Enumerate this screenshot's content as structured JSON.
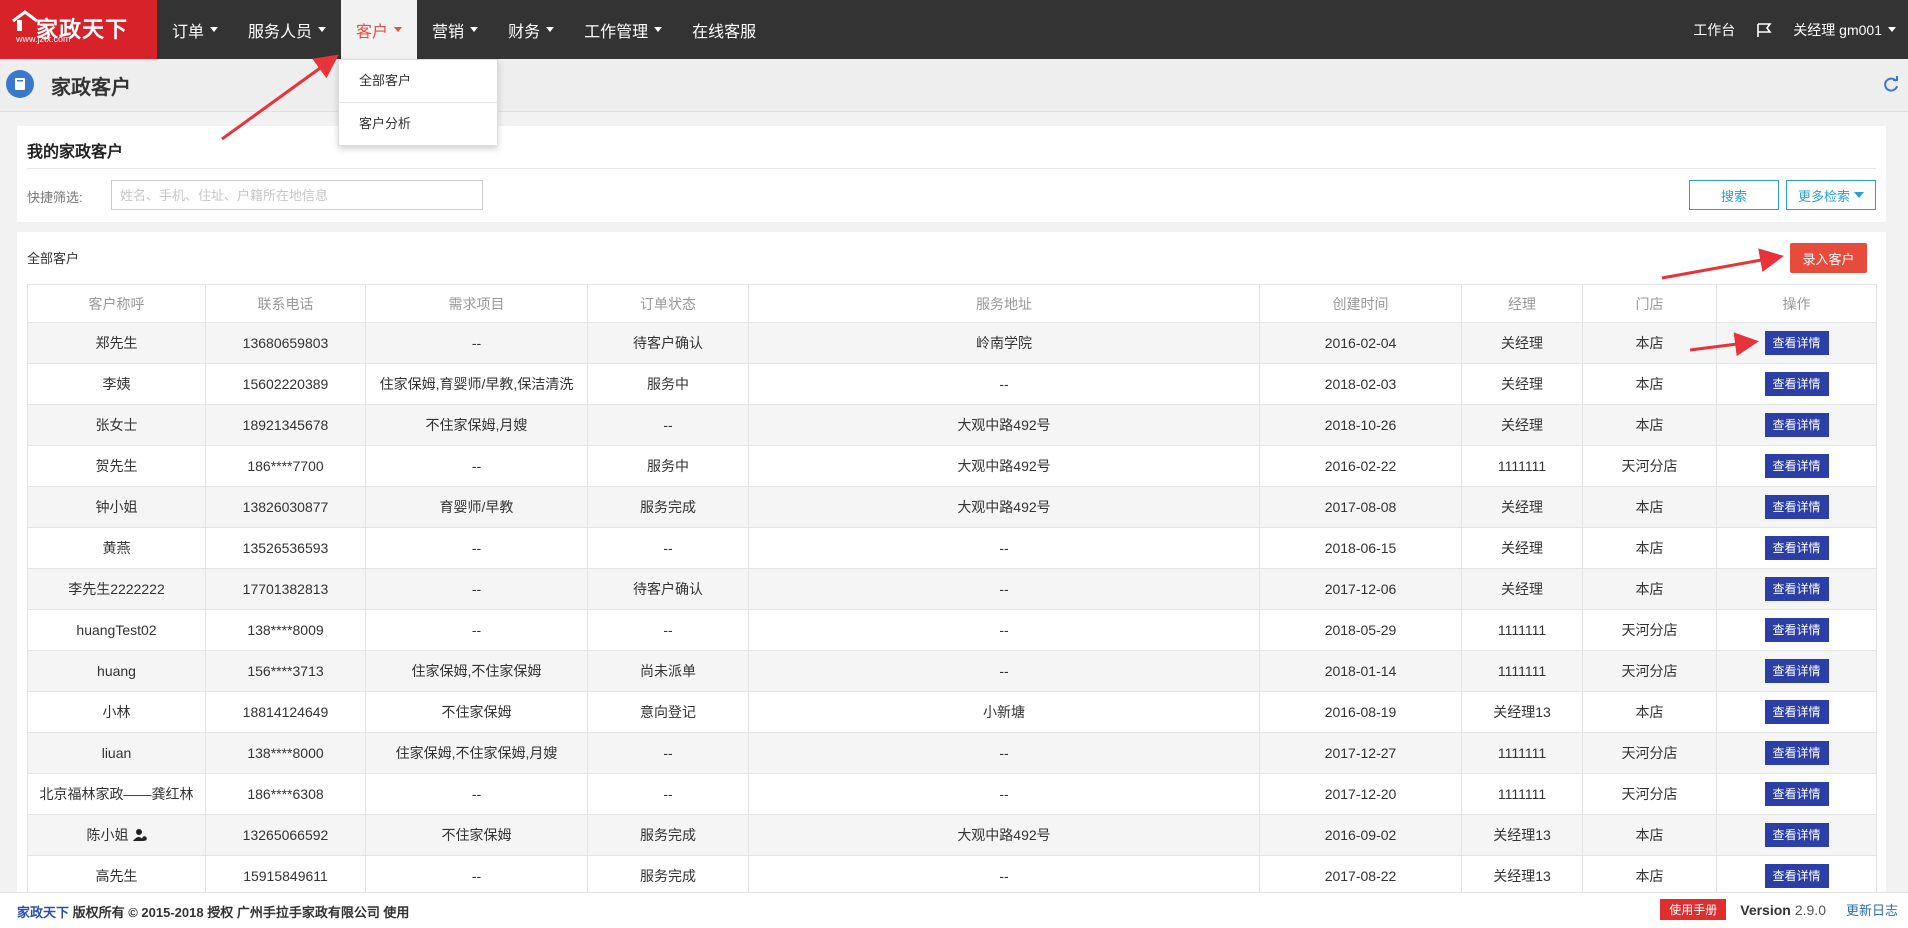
{
  "logo": {
    "text": "家政天下",
    "url": "www.jztx.com"
  },
  "nav": {
    "items": [
      {
        "label": "订单",
        "caret": true,
        "active": false
      },
      {
        "label": "服务人员",
        "caret": true,
        "active": false
      },
      {
        "label": "客户",
        "caret": true,
        "active": true
      },
      {
        "label": "营销",
        "caret": true,
        "active": false
      },
      {
        "label": "财务",
        "caret": true,
        "active": false
      },
      {
        "label": "工作管理",
        "caret": true,
        "active": false
      },
      {
        "label": "在线客服",
        "caret": false,
        "active": false
      }
    ],
    "right": {
      "workbench": "工作台",
      "user": "关经理 gm001"
    }
  },
  "dropdown": {
    "items": [
      "全部客户",
      "客户分析"
    ]
  },
  "page_header": {
    "title": "家政客户"
  },
  "filter": {
    "title": "我的家政客户",
    "label": "快捷筛选:",
    "placeholder": "姓名、手机、住址、户籍所在地信息",
    "search_label": "搜索",
    "more_label": "更多检索"
  },
  "list": {
    "title": "全部客户",
    "add_label": "录入客户",
    "detail_label": "查看详情",
    "columns": [
      "客户称呼",
      "联系电话",
      "需求项目",
      "订单状态",
      "服务地址",
      "创建时间",
      "经理",
      "门店",
      "操作"
    ],
    "rows": [
      [
        "郑先生",
        "13680659803",
        "--",
        "待客户确认",
        "岭南学院",
        "2016-02-04",
        "关经理",
        "本店"
      ],
      [
        "李姨",
        "15602220389",
        "住家保姆,育婴师/早教,保洁清洗",
        "服务中",
        "--",
        "2018-02-03",
        "关经理",
        "本店"
      ],
      [
        "张女士",
        "18921345678",
        "不住家保姆,月嫂",
        "--",
        "大观中路492号",
        "2018-10-26",
        "关经理",
        "本店"
      ],
      [
        "贺先生",
        "186****7700",
        "--",
        "服务中",
        "大观中路492号",
        "2016-02-22",
        "1111111",
        "天河分店"
      ],
      [
        "钟小姐",
        "13826030877",
        "育婴师/早教",
        "服务完成",
        "大观中路492号",
        "2017-08-08",
        "关经理",
        "本店"
      ],
      [
        "黄燕",
        "13526536593",
        "--",
        "--",
        "--",
        "2018-06-15",
        "关经理",
        "本店"
      ],
      [
        "李先生2222222",
        "17701382813",
        "--",
        "待客户确认",
        "--",
        "2017-12-06",
        "关经理",
        "本店"
      ],
      [
        "huangTest02",
        "138****8009",
        "--",
        "--",
        "--",
        "2018-05-29",
        "1111111",
        "天河分店"
      ],
      [
        "huang",
        "156****3713",
        "住家保姆,不住家保姆",
        "尚未派单",
        "--",
        "2018-01-14",
        "1111111",
        "天河分店"
      ],
      [
        "小林",
        "18814124649",
        "不住家保姆",
        "意向登记",
        "小新塘",
        "2016-08-19",
        "关经理13",
        "本店"
      ],
      [
        "liuan",
        "138****8000",
        "住家保姆,不住家保姆,月嫂",
        "--",
        "--",
        "2017-12-27",
        "1111111",
        "天河分店"
      ],
      [
        "北京福林家政——龚红林",
        "186****6308",
        "--",
        "--",
        "--",
        "2017-12-20",
        "1111111",
        "天河分店"
      ],
      [
        "陈小姐",
        "13265066592",
        "不住家保姆",
        "服务完成",
        "大观中路492号",
        "2016-09-02",
        "关经理13",
        "本店"
      ],
      [
        "高先生",
        "15915849611",
        "--",
        "服务完成",
        "--",
        "2017-08-22",
        "关经理13",
        "本店"
      ]
    ]
  },
  "footer": {
    "brand": "家政天下",
    "copyright": " 版权所有 © 2015-2018 授权 广州手拉手家政有限公司 使用",
    "manual": "使用手册",
    "version_label": "Version",
    "version": "2.9.0",
    "changelog": "更新日志"
  },
  "colors": {
    "topbar": "#333333",
    "logo_bg": "#d8222a",
    "active_nav_text": "#e74c3c",
    "primary_blue": "#2a9fd6",
    "detail_button": "#2b3fa6",
    "add_button": "#e74b3c",
    "annotation_arrow": "#e8333a"
  }
}
